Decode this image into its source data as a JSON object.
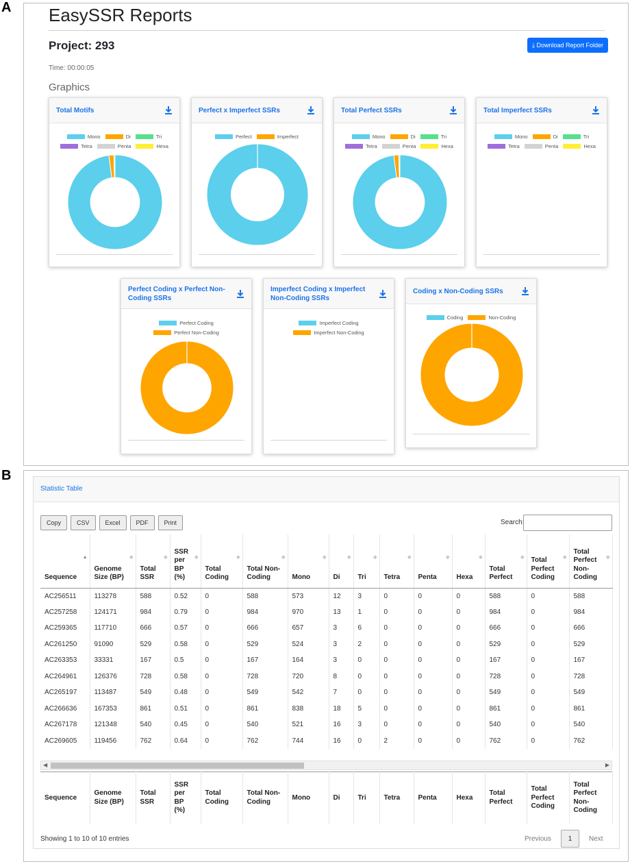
{
  "panel_labels": {
    "a": "A",
    "b": "B"
  },
  "header": {
    "app_title": "EasySSR Reports",
    "project": "Project: 293",
    "time": "Time: 00:00:05",
    "graphics": "Graphics",
    "download_folder": "Download Report Folder"
  },
  "colors": {
    "mono": "#5bcfec",
    "di": "#ffa500",
    "tri": "#55e18a",
    "tetra": "#9e6fdc",
    "penta": "#d3d3d3",
    "hexa": "#ffef33",
    "accent": "#1a73e8",
    "button": "#0d6efd"
  },
  "charts": {
    "total_motifs": {
      "title": "Total Motifs"
    },
    "perfect_imperfect": {
      "title": "Perfect x Imperfect SSRs"
    },
    "total_perfect": {
      "title": "Total Perfect SSRs"
    },
    "total_imperfect": {
      "title": "Total Imperfect SSRs"
    },
    "perf_coding": {
      "title": "Perfect Coding x Perfect Non-Coding SSRs"
    },
    "imperf_coding": {
      "title": "Imperfect Coding x Imperfect Non-Coding SSRs"
    },
    "coding_noncoding": {
      "title": "Coding x Non-Coding SSRs"
    }
  },
  "legends": {
    "motif": [
      "Mono",
      "Di",
      "Tri",
      "Tetra",
      "Penta",
      "Hexa"
    ],
    "perfect": "Perfect",
    "imperfect": "Imperfect",
    "perfect_coding": "Perfect Coding",
    "perfect_noncoding": "Perfect Non-Coding",
    "imperfect_coding": "Imperfect Coding",
    "imperfect_noncoding": "Imperfect Non-Coding",
    "coding": "Coding",
    "noncoding": "Non-Coding"
  },
  "chart_data": [
    {
      "type": "pie",
      "title": "Total Motifs",
      "categories": [
        "Mono",
        "Di",
        "Tri",
        "Tetra",
        "Penta",
        "Hexa"
      ],
      "values": [
        5643,
        99,
        20,
        2,
        0,
        0
      ]
    },
    {
      "type": "pie",
      "title": "Perfect x Imperfect SSRs",
      "categories": [
        "Perfect",
        "Imperfect"
      ],
      "values": [
        6374,
        0
      ]
    },
    {
      "type": "pie",
      "title": "Total Perfect SSRs",
      "categories": [
        "Mono",
        "Di",
        "Tri",
        "Tetra",
        "Penta",
        "Hexa"
      ],
      "values": [
        5643,
        99,
        20,
        2,
        0,
        0
      ]
    },
    {
      "type": "pie",
      "title": "Total Imperfect SSRs",
      "categories": [
        "Mono",
        "Di",
        "Tri",
        "Tetra",
        "Penta",
        "Hexa"
      ],
      "values": []
    },
    {
      "type": "pie",
      "title": "Perfect Coding x Perfect Non-Coding SSRs",
      "categories": [
        "Perfect Coding",
        "Perfect Non-Coding"
      ],
      "values": [
        0,
        6374
      ]
    },
    {
      "type": "pie",
      "title": "Imperfect Coding x Imperfect Non-Coding SSRs",
      "categories": [
        "Imperfect Coding",
        "Imperfect Non-Coding"
      ],
      "values": []
    },
    {
      "type": "pie",
      "title": "Coding x Non-Coding SSRs",
      "categories": [
        "Coding",
        "Non-Coding"
      ],
      "values": [
        0,
        6374
      ]
    }
  ],
  "table": {
    "title": "Statistic Table",
    "buttons": [
      "Copy",
      "CSV",
      "Excel",
      "PDF",
      "Print"
    ],
    "search_label": "Search:",
    "columns": [
      "Sequence",
      "Genome Size (BP)",
      "Total SSR",
      "SSR per BP (%)",
      "Total Coding",
      "Total Non-Coding",
      "Mono",
      "Di",
      "Tri",
      "Tetra",
      "Penta",
      "Hexa",
      "Total Perfect",
      "Total Perfect Coding",
      "Total Perfect Non-Coding"
    ],
    "rows": [
      [
        "AC256511",
        "113278",
        "588",
        "0.52",
        "0",
        "588",
        "573",
        "12",
        "3",
        "0",
        "0",
        "0",
        "588",
        "0",
        "588"
      ],
      [
        "AC257258",
        "124171",
        "984",
        "0.79",
        "0",
        "984",
        "970",
        "13",
        "1",
        "0",
        "0",
        "0",
        "984",
        "0",
        "984"
      ],
      [
        "AC259365",
        "117710",
        "666",
        "0.57",
        "0",
        "666",
        "657",
        "3",
        "6",
        "0",
        "0",
        "0",
        "666",
        "0",
        "666"
      ],
      [
        "AC261250",
        "91090",
        "529",
        "0.58",
        "0",
        "529",
        "524",
        "3",
        "2",
        "0",
        "0",
        "0",
        "529",
        "0",
        "529"
      ],
      [
        "AC263353",
        "33331",
        "167",
        "0.5",
        "0",
        "167",
        "164",
        "3",
        "0",
        "0",
        "0",
        "0",
        "167",
        "0",
        "167"
      ],
      [
        "AC264961",
        "126376",
        "728",
        "0.58",
        "0",
        "728",
        "720",
        "8",
        "0",
        "0",
        "0",
        "0",
        "728",
        "0",
        "728"
      ],
      [
        "AC265197",
        "113487",
        "549",
        "0.48",
        "0",
        "549",
        "542",
        "7",
        "0",
        "0",
        "0",
        "0",
        "549",
        "0",
        "549"
      ],
      [
        "AC266636",
        "167353",
        "861",
        "0.51",
        "0",
        "861",
        "838",
        "18",
        "5",
        "0",
        "0",
        "0",
        "861",
        "0",
        "861"
      ],
      [
        "AC267178",
        "121348",
        "540",
        "0.45",
        "0",
        "540",
        "521",
        "16",
        "3",
        "0",
        "0",
        "0",
        "540",
        "0",
        "540"
      ],
      [
        "AC269605",
        "119456",
        "762",
        "0.64",
        "0",
        "762",
        "744",
        "16",
        "0",
        "2",
        "0",
        "0",
        "762",
        "0",
        "762"
      ]
    ],
    "info": "Showing 1 to 10 of 10 entries",
    "pagination": {
      "previous": "Previous",
      "page": "1",
      "next": "Next"
    }
  }
}
